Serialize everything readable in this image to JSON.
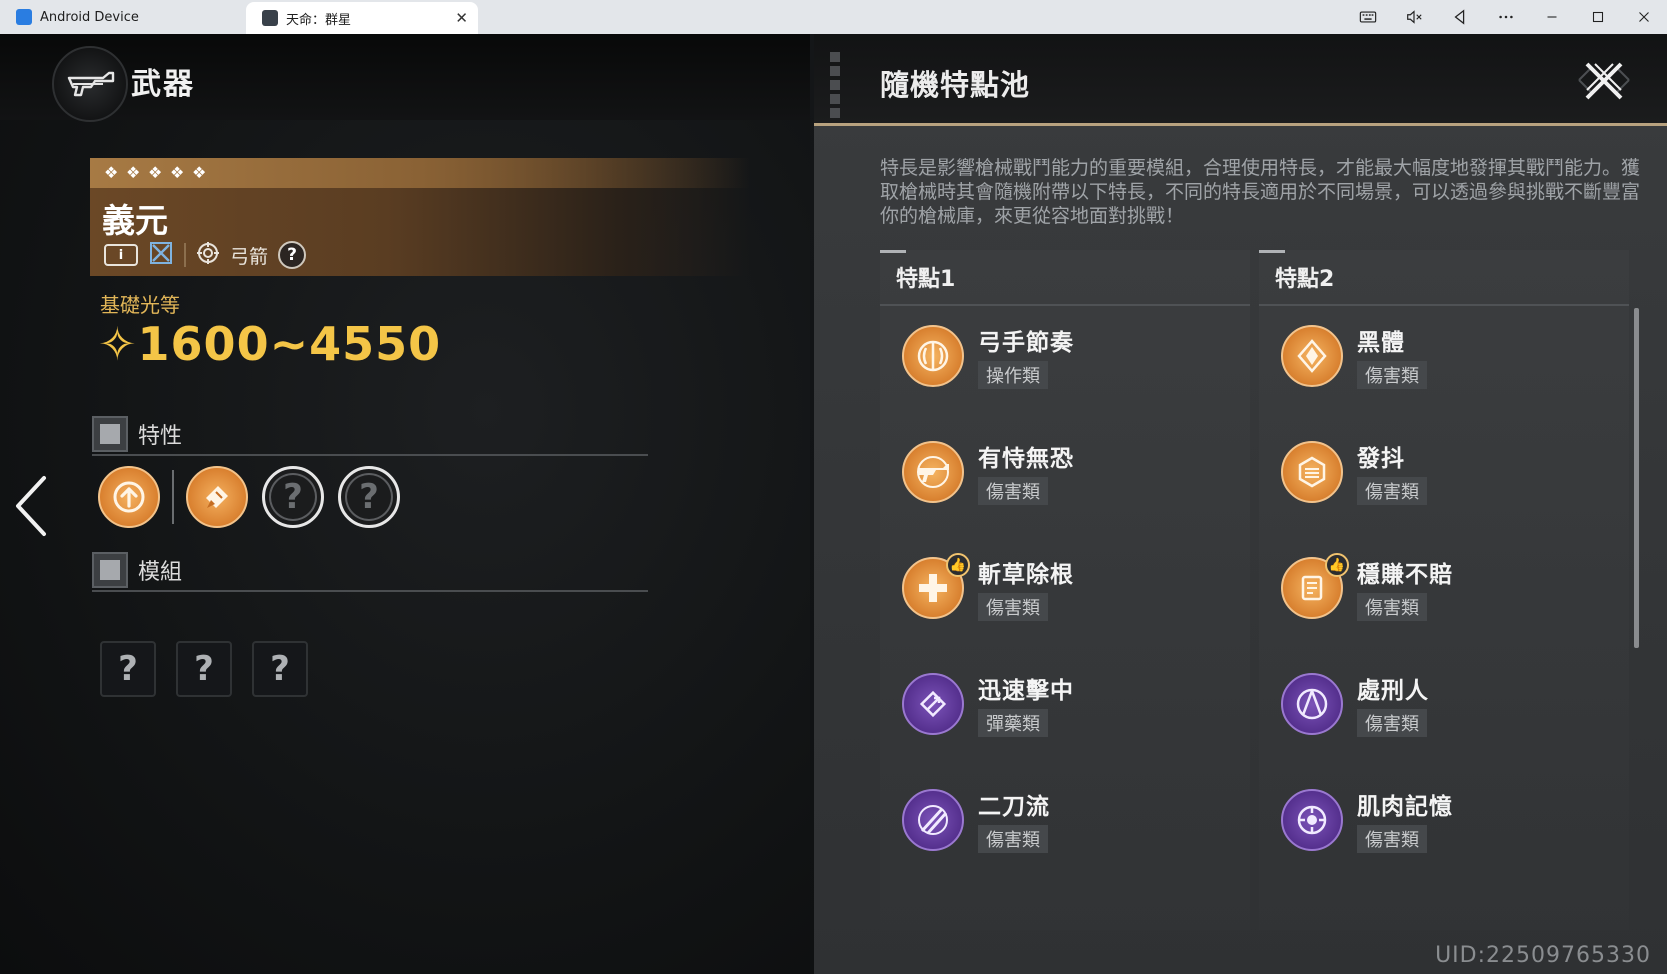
{
  "window": {
    "tabs": [
      {
        "label": "Android Device",
        "active": false
      },
      {
        "label": "天命：群星",
        "active": true
      }
    ],
    "controls": [
      "keyboard-icon",
      "mute-icon",
      "back-icon",
      "more-icon",
      "minimize-icon",
      "maximize-icon",
      "close-icon"
    ]
  },
  "left": {
    "header_title": "武器",
    "weapon_name": "義元",
    "stars": 5,
    "weapon_type": "弓箭",
    "base_label": "基礎光等",
    "base_value": "✧1600~4550",
    "traits_label": "特性",
    "modules_label": "模組",
    "trait_slots": [
      "upgrade-arrow",
      "hammer",
      "?",
      "?"
    ],
    "module_slots": [
      "?",
      "?",
      "?"
    ]
  },
  "right": {
    "title": "隨機特點池",
    "description": "特長是影響槍械戰鬥能力的重要模組，合理使用特長，才能最大幅度地發揮其戰鬥能力。獲取槍械時其會隨機附帶以下特長，不同的特長適用於不同場景，可以透過參與挑戰不斷豐富你的槍械庫，來更從容地面對挑戰！",
    "columns": [
      {
        "title": "特點1",
        "perks": [
          {
            "name": "弓手節奏",
            "type": "操作類",
            "color": "orange",
            "recommended": false
          },
          {
            "name": "有恃無恐",
            "type": "傷害類",
            "color": "orange",
            "recommended": false
          },
          {
            "name": "斬草除根",
            "type": "傷害類",
            "color": "orange",
            "recommended": true
          },
          {
            "name": "迅速擊中",
            "type": "彈藥類",
            "color": "purple",
            "recommended": false
          },
          {
            "name": "二刀流",
            "type": "傷害類",
            "color": "purple",
            "recommended": false
          }
        ]
      },
      {
        "title": "特點2",
        "perks": [
          {
            "name": "黑體",
            "type": "傷害類",
            "color": "orange",
            "recommended": false
          },
          {
            "name": "發抖",
            "type": "傷害類",
            "color": "orange",
            "recommended": false
          },
          {
            "name": "穩賺不賠",
            "type": "傷害類",
            "color": "orange",
            "recommended": true
          },
          {
            "name": "處刑人",
            "type": "傷害類",
            "color": "purple",
            "recommended": false
          },
          {
            "name": "肌肉記憶",
            "type": "傷害類",
            "color": "purple",
            "recommended": false
          }
        ]
      }
    ]
  },
  "uid": "UID:22509765330",
  "colors": {
    "accent_gold": "#f4c547",
    "perk_orange": "#d8802f",
    "perk_purple": "#55308e"
  }
}
